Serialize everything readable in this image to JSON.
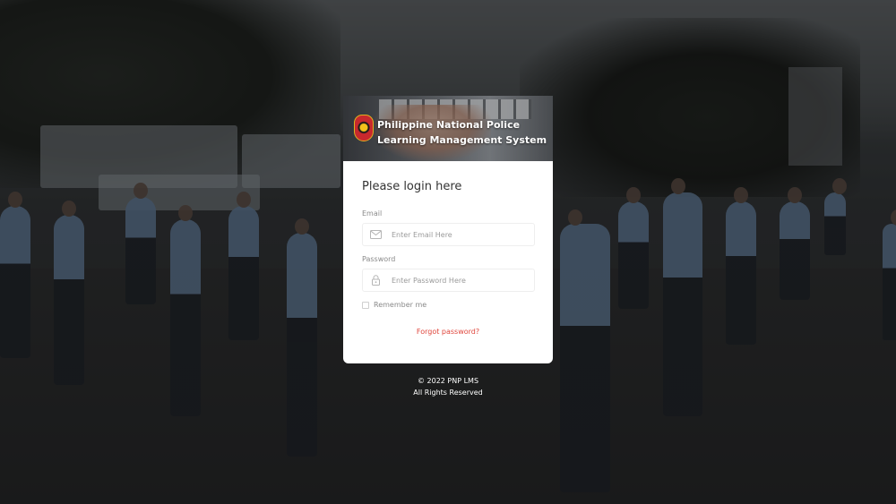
{
  "banner": {
    "title_line1": "Philippine National Police",
    "title_line2": "Learning Management System"
  },
  "login": {
    "heading": "Please login here",
    "email_label": "Email",
    "email_placeholder": "Enter Email Here",
    "email_value": "",
    "password_label": "Password",
    "password_placeholder": "Enter Password Here",
    "password_value": "",
    "remember_label": "Remember me",
    "remember_checked": false,
    "forgot_link": "Forgot password?"
  },
  "footer": {
    "copyright": "© 2022 PNP LMS",
    "rights": "All Rights Reserved"
  },
  "icons": {
    "email": "envelope-icon",
    "password": "lock-icon",
    "logo": "pnp-seal"
  },
  "colors": {
    "link": "#e0463c",
    "card_background": "#ffffff"
  }
}
